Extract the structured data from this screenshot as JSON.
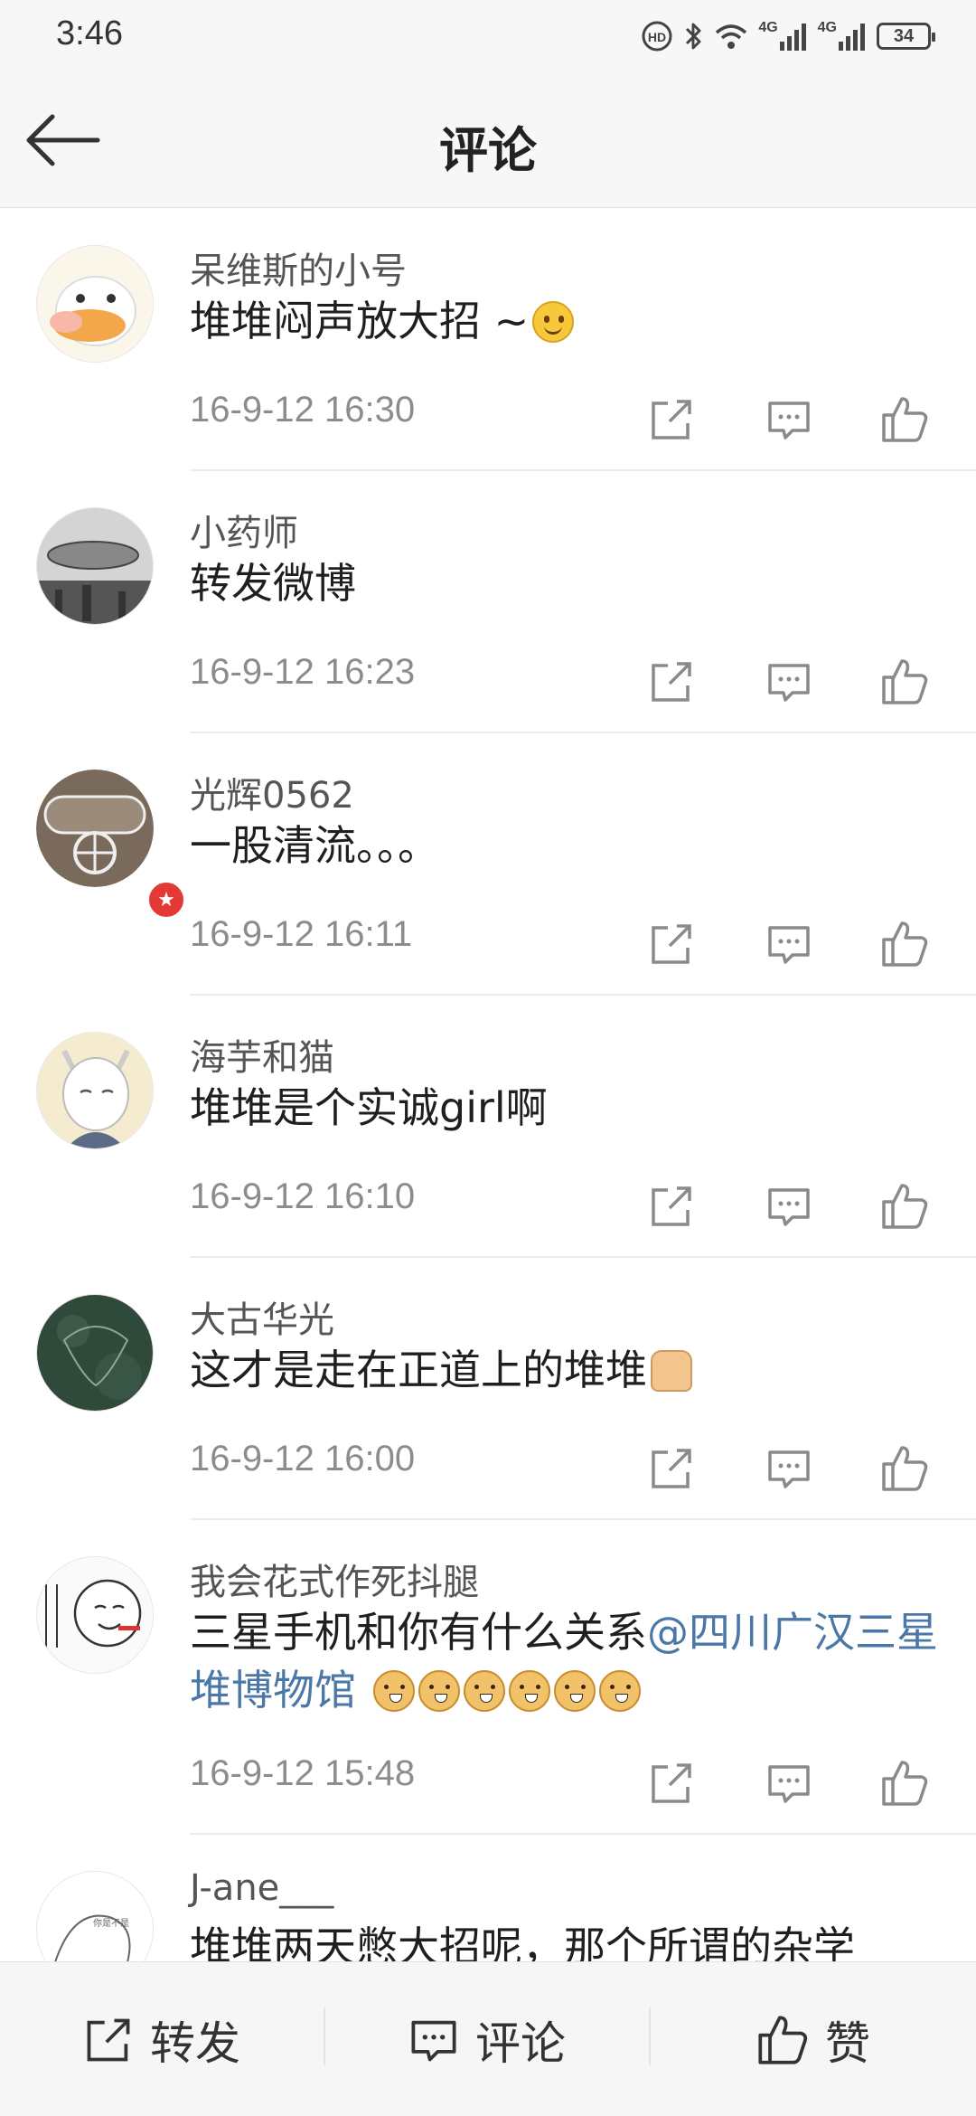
{
  "status_bar": {
    "time": "3:46",
    "network_1": "4G",
    "network_2": "4G",
    "battery": "34"
  },
  "nav": {
    "title": "评论"
  },
  "comments": [
    {
      "username": "呆维斯的小号",
      "text": "堆堆闷声放大招 ~",
      "time": "16-9-12 16:30"
    },
    {
      "username": "小药师",
      "text": "转发微博",
      "time": "16-9-12 16:23"
    },
    {
      "username": "光辉0562",
      "text": "一股清流。。。",
      "time": "16-9-12 16:11"
    },
    {
      "username": "海芋和猫",
      "text": "堆堆是个实诚girl啊",
      "time": "16-9-12 16:10"
    },
    {
      "username": "大古华光",
      "text": "这才是走在正道上的堆堆",
      "time": "16-9-12 16:00"
    },
    {
      "username": "我会花式作死抖腿",
      "text": "三星手机和你有什么关系",
      "mention": "@四川广汉三星堆博物馆",
      "time": "16-9-12 15:48"
    },
    {
      "username": "J-ane___",
      "text": "堆堆两天憋大招呢，那个所谓的杂学"
    }
  ],
  "bottom_bar": {
    "repost": "转发",
    "comment": "评论",
    "like": "赞"
  },
  "colors": {
    "mention": "#4a77a8",
    "vip_badge": "#e53935"
  }
}
